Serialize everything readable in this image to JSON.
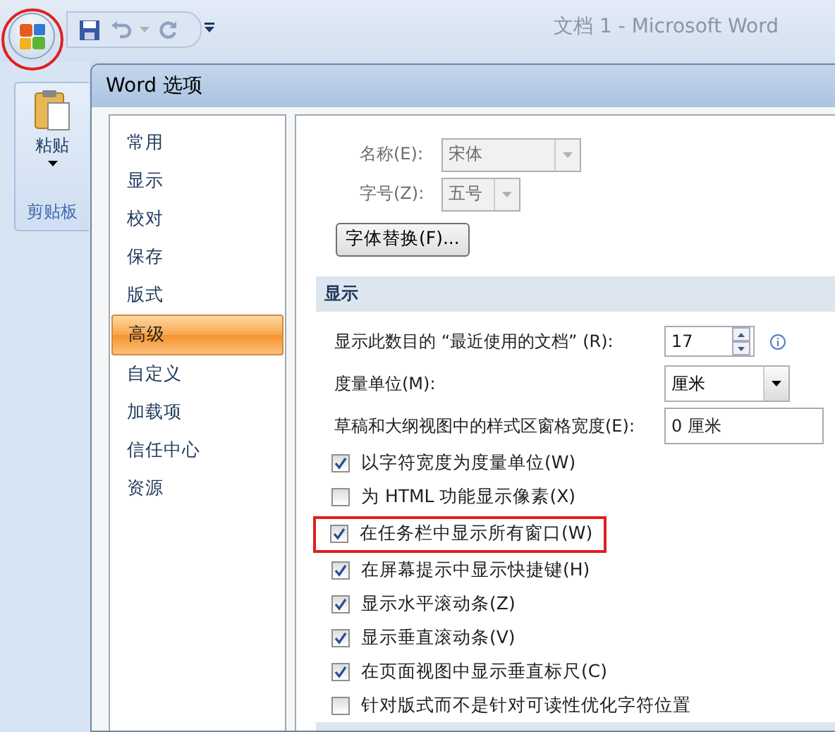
{
  "window": {
    "title": "文档 1 - Microsoft Word",
    "office_button_highlighted": true
  },
  "ribbon": {
    "paste_label": "粘贴",
    "group_label": "剪贴板"
  },
  "dialog": {
    "title": "Word 选项",
    "nav": [
      {
        "label": "常用",
        "selected": false
      },
      {
        "label": "显示",
        "selected": false
      },
      {
        "label": "校对",
        "selected": false
      },
      {
        "label": "保存",
        "selected": false
      },
      {
        "label": "版式",
        "selected": false
      },
      {
        "label": "高级",
        "selected": true
      },
      {
        "label": "自定义",
        "selected": false
      },
      {
        "label": "加载项",
        "selected": false
      },
      {
        "label": "信任中心",
        "selected": false
      },
      {
        "label": "资源",
        "selected": false
      }
    ],
    "font_fields": [
      {
        "label": "名称(E):",
        "value": "宋体",
        "disabled": true,
        "wide": true
      },
      {
        "label": "字号(Z):",
        "value": "五号",
        "disabled": true,
        "wide": false
      }
    ],
    "font_button": "字体替换(F)...",
    "section": "显示",
    "fields": [
      {
        "kind": "spinner",
        "label": "显示此数目的 “最近使用的文档” (R):",
        "value": "17"
      },
      {
        "kind": "dropdown",
        "label": "度量单位(M):",
        "value": "厘米"
      },
      {
        "kind": "text",
        "label": "草稿和大纲视图中的样式区窗格宽度(E):",
        "value": "0 厘米"
      }
    ],
    "options": [
      {
        "label": "以字符宽度为度量单位(W)",
        "checked": true,
        "highlighted": false
      },
      {
        "label": "为 HTML 功能显示像素(X)",
        "checked": false,
        "highlighted": false
      },
      {
        "label": "在任务栏中显示所有窗口(W)",
        "checked": true,
        "highlighted": true
      },
      {
        "label": "在屏幕提示中显示快捷键(H)",
        "checked": true,
        "highlighted": false
      },
      {
        "label": "显示水平滚动条(Z)",
        "checked": true,
        "highlighted": false
      },
      {
        "label": "显示垂直滚动条(V)",
        "checked": true,
        "highlighted": false
      },
      {
        "label": "在页面视图中显示垂直标尺(C)",
        "checked": true,
        "highlighted": false
      },
      {
        "label": "针对版式而不是针对可读性优化字符位置",
        "checked": false,
        "highlighted": false
      }
    ]
  }
}
